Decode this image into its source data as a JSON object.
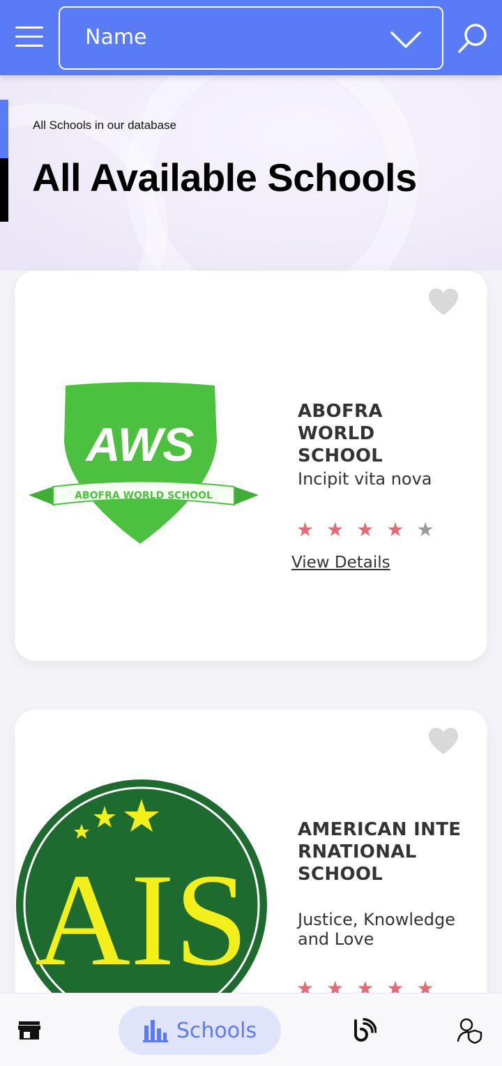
{
  "topbar": {
    "select_label": "Name"
  },
  "hero": {
    "subtitle": "All Schools in our database",
    "title": "All Available Schools"
  },
  "schools": [
    {
      "name": "ABOFRA WORLD SCHOOL",
      "motto": "Incipit vita nova",
      "rating": 4,
      "max_rating": 5,
      "view_label": "View Details",
      "logo": {
        "letters": "AWS",
        "banner": "ABOFRA WORLD SCHOOL",
        "color": "#4cc13f"
      }
    },
    {
      "name": "AMERICAN INTE RNATIONAL SCHOOL",
      "motto": "Justice, Knowledge and Love",
      "rating": 5,
      "max_rating": 5,
      "logo": {
        "letters": "AIS",
        "color": "#1e6b30",
        "accent": "#f3ef1a"
      }
    }
  ],
  "bottom_nav": {
    "schools_label": "Schools"
  },
  "colors": {
    "primary": "#5a7bf7",
    "star_on": "#e46a76",
    "star_off": "#9a9a9a"
  }
}
